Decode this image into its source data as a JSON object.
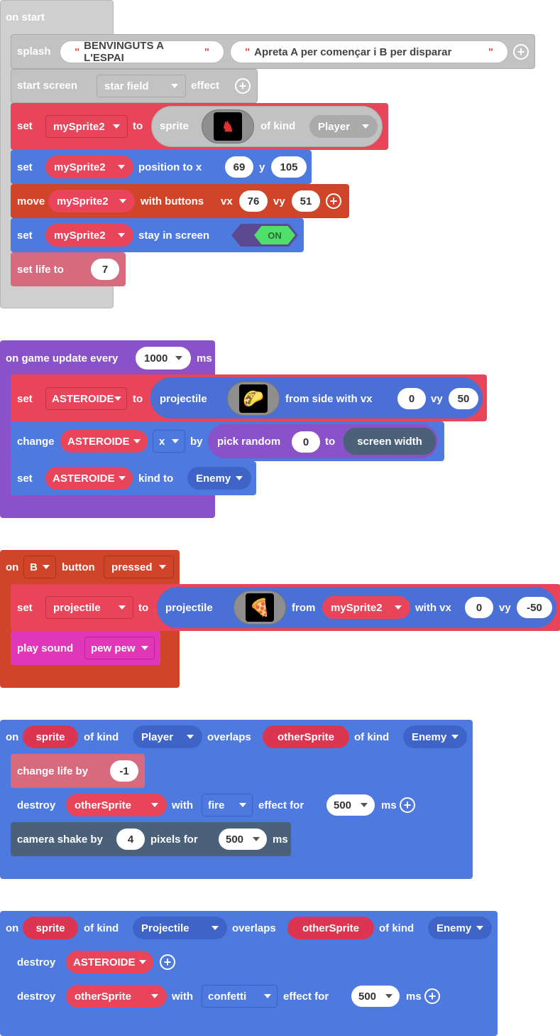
{
  "colors": {
    "hat_gray": "#cfcfcf",
    "scene": "#c2c2c2",
    "sprites": "#e8445a",
    "sprite_text_pill": "#db3552",
    "blue": "#4e7ae0",
    "orange": "#d0452a",
    "life": "#d86a80",
    "purple": "#8a52c8",
    "magenta": "#e036b8",
    "camera": "#4a6179",
    "pill_blue": "#4a70d6",
    "toggle_on": "#4ee06a"
  },
  "on_start": {
    "hat": "on start",
    "splash": {
      "label": "splash",
      "text1": "BENVINGUTS A L'ESPAI",
      "text2": "Apreta A per començar i B per disparar"
    },
    "start_screen": {
      "label": "start screen",
      "effect": "star field",
      "suffix": "effect"
    },
    "set_sprite": {
      "label": "set",
      "var": "mySprite2",
      "to": "to",
      "sprite": "sprite",
      "of_kind": "of kind",
      "kind": "Player"
    },
    "set_position": {
      "label": "set",
      "var": "mySprite2",
      "text": "position to x",
      "x": "69",
      "y_label": "y",
      "y": "105"
    },
    "move": {
      "label": "move",
      "var": "mySprite2",
      "text": "with buttons",
      "vx_label": "vx",
      "vx": "76",
      "vy_label": "vy",
      "vy": "51"
    },
    "stay": {
      "label": "set",
      "var": "mySprite2",
      "text": "stay in screen",
      "toggle": "ON"
    },
    "life": {
      "label": "set life to",
      "value": "7"
    }
  },
  "on_update": {
    "hat": "on game update every",
    "interval": "1000",
    "unit": "ms",
    "set_proj": {
      "label": "set",
      "var": "ASTEROIDE",
      "to": "to",
      "proj": "projectile",
      "from_side": "from side with vx",
      "vx": "0",
      "vy_label": "vy",
      "vy": "50"
    },
    "change": {
      "label": "change",
      "var": "ASTEROIDE",
      "prop": "x",
      "by": "by",
      "pick": "pick random",
      "from": "0",
      "to": "to",
      "screen": "screen width"
    },
    "set_kind": {
      "label": "set",
      "var": "ASTEROIDE",
      "kind_to": "kind to",
      "kind": "Enemy"
    }
  },
  "on_button": {
    "on": "on",
    "button": "B",
    "button_label": "button",
    "event": "pressed",
    "set_proj": {
      "label": "set",
      "var": "projectile",
      "to": "to",
      "proj": "projectile",
      "from": "from",
      "sprite": "mySprite2",
      "with_vx": "with vx",
      "vx": "0",
      "vy_label": "vy",
      "vy": "-50"
    },
    "sound": {
      "label": "play sound",
      "sound": "pew pew"
    }
  },
  "overlap1": {
    "on": "on",
    "sprite": "sprite",
    "of_kind": "of kind",
    "kind1": "Player",
    "overlaps": "overlaps",
    "other": "otherSprite",
    "of_kind2": "of kind",
    "kind2": "Enemy",
    "change_life": {
      "label": "change life by",
      "value": "-1"
    },
    "destroy": {
      "label": "destroy",
      "var": "otherSprite",
      "with": "with",
      "effect": "fire",
      "effect_for": "effect for",
      "ms": "500",
      "unit": "ms"
    },
    "shake": {
      "label": "camera shake by",
      "value": "4",
      "pixels_for": "pixels for",
      "ms": "500",
      "unit": "ms"
    }
  },
  "overlap2": {
    "on": "on",
    "sprite": "sprite",
    "of_kind": "of kind",
    "kind1": "Projectile",
    "overlaps": "overlaps",
    "other": "otherSprite",
    "of_kind2": "of kind",
    "kind2": "Enemy",
    "destroy1": {
      "label": "destroy",
      "var": "ASTEROIDE"
    },
    "destroy2": {
      "label": "destroy",
      "var": "otherSprite",
      "with": "with",
      "effect": "confetti",
      "effect_for": "effect for",
      "ms": "500",
      "unit": "ms"
    }
  }
}
